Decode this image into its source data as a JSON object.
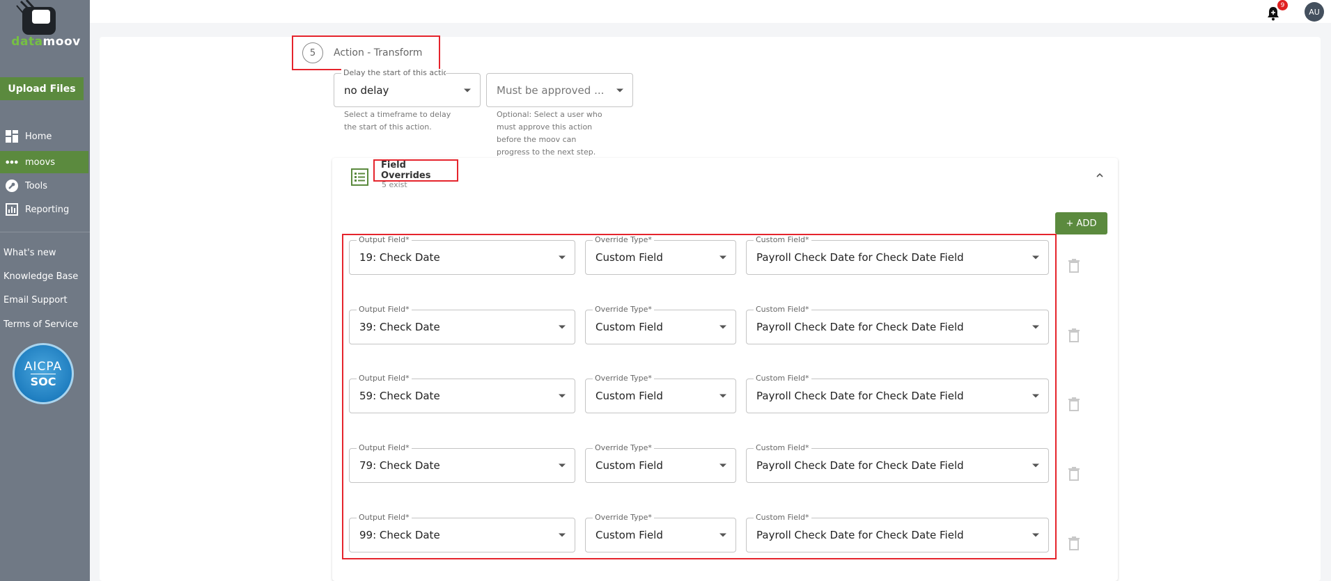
{
  "brand": {
    "logo_part1": "data",
    "logo_part2": "moov",
    "accent": "#5b8a3e",
    "logo_green": "#76c043"
  },
  "sidebar": {
    "upload_label": "Upload Files",
    "nav": [
      {
        "label": "Home",
        "icon": "home-icon"
      },
      {
        "label": "moovs",
        "icon": "moovs-icon"
      },
      {
        "label": "Tools",
        "icon": "tools-icon"
      },
      {
        "label": "Reporting",
        "icon": "reporting-icon"
      }
    ],
    "links": [
      "What's new",
      "Knowledge Base",
      "Email Support",
      "Terms of Service"
    ],
    "badge": {
      "line1": "AICPA",
      "line2": "SOC"
    }
  },
  "topbar": {
    "notification_count": "9",
    "avatar_initials": "AU"
  },
  "step": {
    "number": "5",
    "title": "Action - Transform"
  },
  "delay": {
    "legend": "Delay the start of this action",
    "value": "no delay",
    "helper_line1": "Select a timeframe to delay",
    "helper_line2": "the start of this action."
  },
  "approval": {
    "placeholder": "Must be approved ...",
    "helper_line1": "Optional: Select a user who",
    "helper_line2": "must approve this action",
    "helper_line3": "before the moov can",
    "helper_line4": "progress to the next step."
  },
  "overrides": {
    "title": "Field Overrides",
    "subtitle": "5 exist",
    "add_label": "+ ADD",
    "labels": {
      "output": "Output Field*",
      "type": "Override Type*",
      "custom": "Custom Field*"
    },
    "rows": [
      {
        "output": "19: Check Date",
        "type": "Custom Field",
        "custom": "Payroll Check Date for Check Date Field"
      },
      {
        "output": "39: Check Date",
        "type": "Custom Field",
        "custom": "Payroll Check Date for Check Date Field"
      },
      {
        "output": "59: Check Date",
        "type": "Custom Field",
        "custom": "Payroll Check Date for Check Date Field"
      },
      {
        "output": "79: Check Date",
        "type": "Custom Field",
        "custom": "Payroll Check Date for Check Date Field"
      },
      {
        "output": "99: Check Date",
        "type": "Custom Field",
        "custom": "Payroll Check Date for Check Date Field"
      }
    ]
  }
}
